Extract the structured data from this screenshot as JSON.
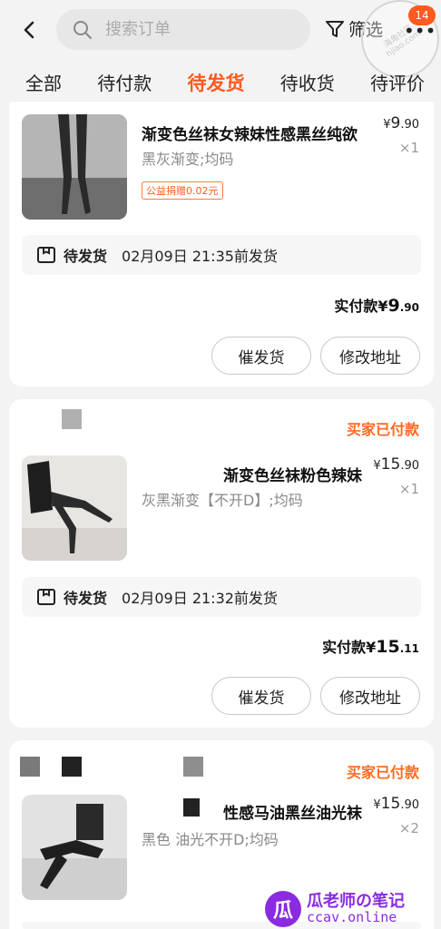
{
  "header": {
    "search_placeholder": "搜索订单",
    "filter_label": "筛选",
    "more_label": "•••",
    "badge_count": "14",
    "watermark_text": "海角社区 hjlao.com"
  },
  "tabs": [
    {
      "label": "全部"
    },
    {
      "label": "待付款"
    },
    {
      "label": "待发货",
      "active": true
    },
    {
      "label": "待收货"
    },
    {
      "label": "待评价"
    }
  ],
  "orders": [
    {
      "store_status": "",
      "title": "渐变色丝袜女辣妹性感黑丝纯欲",
      "price_symbol": "¥",
      "price_int": "9",
      "price_dec": ".90",
      "qty": "×1",
      "spec": "黑灰渐变;均码",
      "charity": "公益捐赠0.02元",
      "status_label": "待发货",
      "status_time": "02月09日 21:35前发货",
      "paid_label": "实付款",
      "paid_symbol": "¥",
      "paid_int": "9",
      "paid_dec": ".90",
      "btn_urge": "催发货",
      "btn_address": "修改地址"
    },
    {
      "store_status": "买家已付款",
      "title": "渐变色丝袜粉色辣妹",
      "price_symbol": "¥",
      "price_int": "15",
      "price_dec": ".90",
      "qty": "×1",
      "spec": "灰黑渐变【不开D】;均码",
      "status_label": "待发货",
      "status_time": "02月09日 21:32前发货",
      "paid_label": "实付款",
      "paid_symbol": "¥",
      "paid_int": "15",
      "paid_dec": ".11",
      "btn_urge": "催发货",
      "btn_address": "修改地址"
    },
    {
      "store_status": "买家已付款",
      "title": "性感马油黑丝油光袜",
      "price_symbol": "¥",
      "price_int": "15",
      "price_dec": ".90",
      "qty": "×2",
      "spec": "黑色 油光不开D;均码"
    }
  ],
  "overlay_watermark": {
    "logo": "瓜",
    "line1": "瓜老师の笔记",
    "line2": "ccav.online"
  },
  "colors": {
    "accent": "#ff5a1f",
    "background": "#f3f3f3"
  }
}
